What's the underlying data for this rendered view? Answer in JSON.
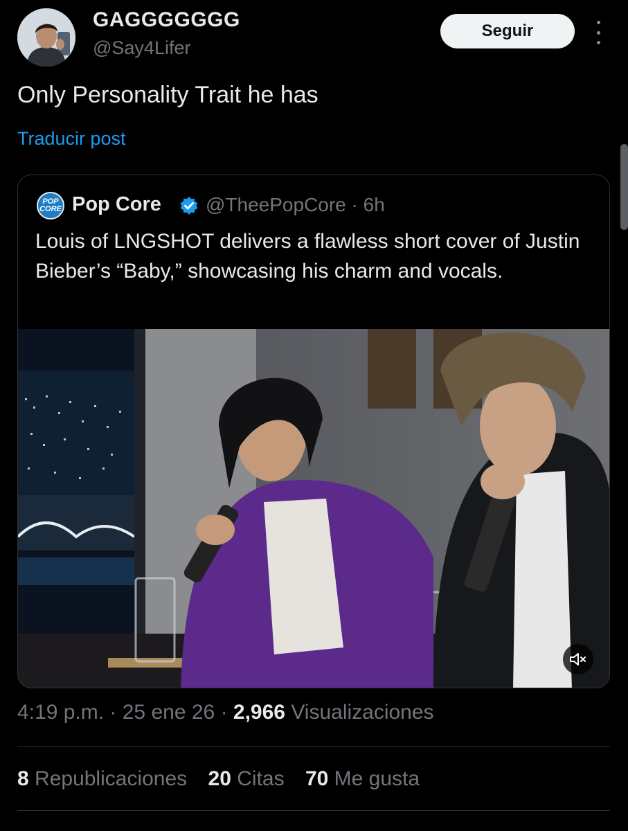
{
  "author": {
    "display_name": "GAGGGGGGG",
    "handle": "@Say4Lifer",
    "follow_label": "Seguir"
  },
  "post": {
    "text": "Only Personality Trait he has",
    "translate_label": "Traducir post"
  },
  "quoted": {
    "logo_text": [
      "POP",
      "CORE"
    ],
    "name": "Pop Core",
    "handle": "@TheePopCore",
    "separator": "·",
    "time_ago": "6h",
    "text": "Louis of LNGSHOT delivers a flawless short cover of Justin Bieber’s “Baby,” showcasing his charm and vocals.",
    "media_type": "video",
    "verified_color": "#1d9bf0"
  },
  "meta": {
    "time": "4:19 p.m.",
    "date": "25 ene 26",
    "views_count": "2,966",
    "views_label": "Visualizaciones"
  },
  "stats": [
    {
      "count": "8",
      "label": "Republicaciones"
    },
    {
      "count": "20",
      "label": "Citas"
    },
    {
      "count": "70",
      "label": "Me gusta"
    }
  ],
  "icons": {
    "more": "more-vertical-icon",
    "verified": "verified-badge-icon",
    "mute": "volume-muted-icon"
  },
  "colors": {
    "background": "#000000",
    "accent": "#1d9bf0",
    "secondary_text": "#71767b",
    "primary_text": "#e7e9ea"
  }
}
